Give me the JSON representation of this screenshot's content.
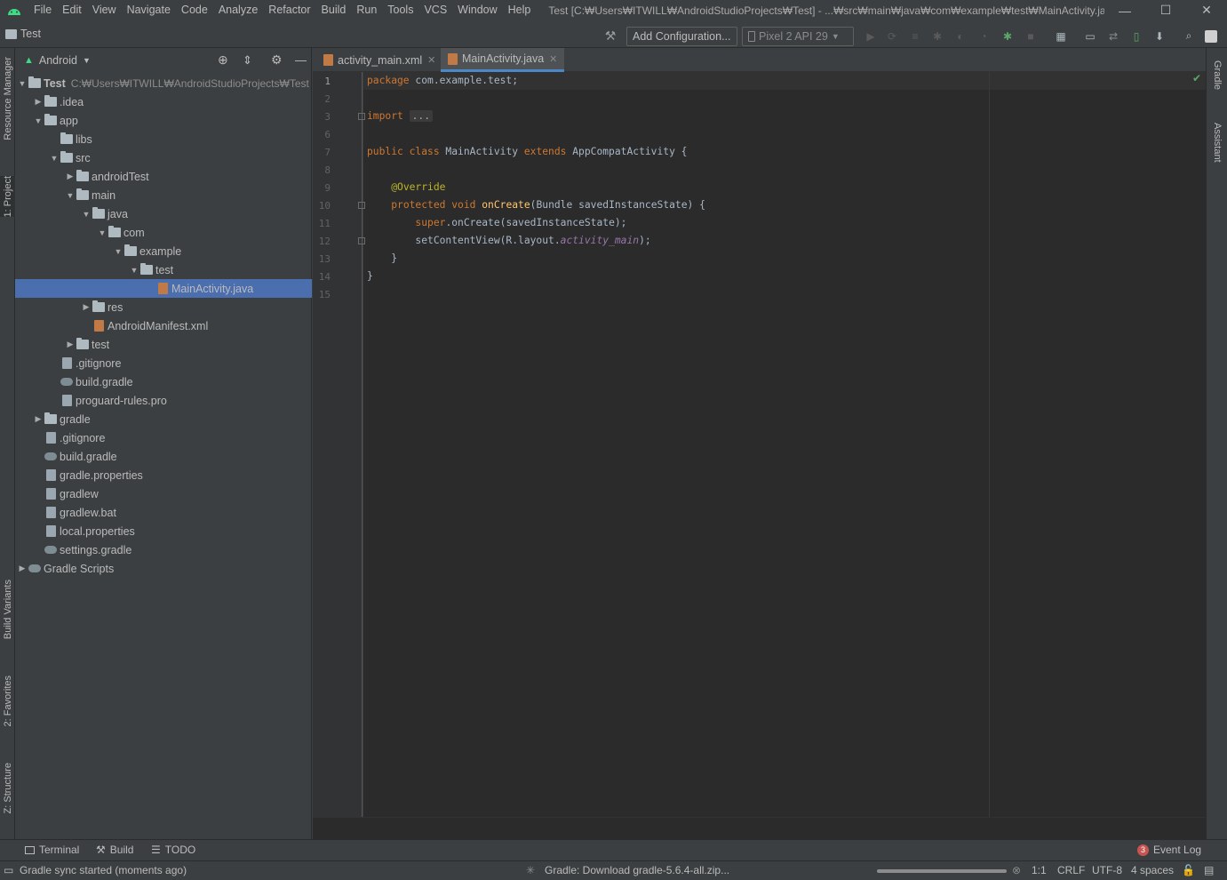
{
  "menu": {
    "items": [
      "File",
      "Edit",
      "View",
      "Navigate",
      "Code",
      "Analyze",
      "Refactor",
      "Build",
      "Run",
      "Tools",
      "VCS",
      "Window",
      "Help"
    ],
    "window_title": "Test [C:₩Users₩ITWILL₩AndroidStudioProjects₩Test] - ...₩src₩main₩java₩com₩example₩test₩MainActivity.java"
  },
  "navbar": {
    "project": "Test",
    "add_config": "Add Configuration...",
    "device": "Pixel 2 API 29"
  },
  "left_tabs": [
    "Resource Manager",
    "1: Project",
    "Build Variants",
    "2: Favorites",
    "Z: Structure"
  ],
  "right_tabs": [
    "Gradle",
    "Assistant"
  ],
  "project_panel": {
    "view": "Android",
    "root_name": "Test",
    "root_path": "C:₩Users₩ITWILL₩AndroidStudioProjects₩Test",
    "tree": [
      {
        "label": "Test",
        "depth": 0,
        "arrow": "down",
        "icon": "project-folder-icon"
      },
      {
        "label": ".idea",
        "depth": 1,
        "arrow": "right",
        "icon": "folder-icon"
      },
      {
        "label": "app",
        "depth": 1,
        "arrow": "down",
        "icon": "folder-icon"
      },
      {
        "label": "libs",
        "depth": 2,
        "arrow": "",
        "icon": "folder-icon"
      },
      {
        "label": "src",
        "depth": 2,
        "arrow": "down",
        "icon": "folder-icon"
      },
      {
        "label": "androidTest",
        "depth": 3,
        "arrow": "right",
        "icon": "folder-icon"
      },
      {
        "label": "main",
        "depth": 3,
        "arrow": "down",
        "icon": "folder-icon"
      },
      {
        "label": "java",
        "depth": 4,
        "arrow": "down",
        "icon": "folder-icon"
      },
      {
        "label": "com",
        "depth": 5,
        "arrow": "down",
        "icon": "folder-icon"
      },
      {
        "label": "example",
        "depth": 6,
        "arrow": "down",
        "icon": "folder-icon"
      },
      {
        "label": "test",
        "depth": 7,
        "arrow": "down",
        "icon": "folder-icon"
      },
      {
        "label": "MainActivity.java",
        "depth": 8,
        "arrow": "",
        "icon": "java-file-icon",
        "selected": true
      },
      {
        "label": "res",
        "depth": 4,
        "arrow": "right",
        "icon": "folder-icon"
      },
      {
        "label": "AndroidManifest.xml",
        "depth": 4,
        "arrow": "",
        "icon": "manifest-file-icon"
      },
      {
        "label": "test",
        "depth": 3,
        "arrow": "right",
        "icon": "folder-icon"
      },
      {
        "label": ".gitignore",
        "depth": 2,
        "arrow": "",
        "icon": "gitignore-file-icon"
      },
      {
        "label": "build.gradle",
        "depth": 2,
        "arrow": "",
        "icon": "gradle-file-icon"
      },
      {
        "label": "proguard-rules.pro",
        "depth": 2,
        "arrow": "",
        "icon": "text-file-icon"
      },
      {
        "label": "gradle",
        "depth": 1,
        "arrow": "right",
        "icon": "folder-icon"
      },
      {
        "label": ".gitignore",
        "depth": 1,
        "arrow": "",
        "icon": "gitignore-file-icon"
      },
      {
        "label": "build.gradle",
        "depth": 1,
        "arrow": "",
        "icon": "gradle-file-icon"
      },
      {
        "label": "gradle.properties",
        "depth": 1,
        "arrow": "",
        "icon": "properties-file-icon"
      },
      {
        "label": "gradlew",
        "depth": 1,
        "arrow": "",
        "icon": "script-file-icon"
      },
      {
        "label": "gradlew.bat",
        "depth": 1,
        "arrow": "",
        "icon": "text-file-icon"
      },
      {
        "label": "local.properties",
        "depth": 1,
        "arrow": "",
        "icon": "properties-file-icon"
      },
      {
        "label": "settings.gradle",
        "depth": 1,
        "arrow": "",
        "icon": "gradle-file-icon"
      },
      {
        "label": "Gradle Scripts",
        "depth": 0,
        "arrow": "right",
        "icon": "gradle-scripts-icon"
      }
    ]
  },
  "editor_tabs": [
    {
      "label": "activity_main.xml",
      "active": false
    },
    {
      "label": "MainActivity.java",
      "active": true
    }
  ],
  "code_lines": [
    {
      "n": "1",
      "html": "<span class=\"kw\">package</span> com.example.test;"
    },
    {
      "n": "2",
      "html": ""
    },
    {
      "n": "3",
      "html": "<span class=\"kw\">import</span> <span class=\"fold\">...</span>"
    },
    {
      "n": "6",
      "html": ""
    },
    {
      "n": "7",
      "html": "<span class=\"kw\">public class</span> MainActivity <span class=\"kw\">extends</span> AppCompatActivity {"
    },
    {
      "n": "8",
      "html": ""
    },
    {
      "n": "9",
      "html": "    <span class=\"ann\">@Override</span>"
    },
    {
      "n": "10",
      "html": "    <span class=\"kw\">protected void</span> <span class=\"mth\">onCreate</span>(Bundle savedInstanceState) {"
    },
    {
      "n": "11",
      "html": "        <span class=\"kw\">super</span>.onCreate(savedInstanceState);"
    },
    {
      "n": "12",
      "html": "        setContentView(R.layout.<span class=\"kw\" style=\"color:#9876aa;font-style:italic\">activity_main</span>);"
    },
    {
      "n": "13",
      "html": "    }"
    },
    {
      "n": "14",
      "html": "}"
    },
    {
      "n": "15",
      "html": ""
    }
  ],
  "bottom_tabs": [
    "Terminal",
    "Build",
    "TODO"
  ],
  "event_log": {
    "label": "Event Log",
    "count": "3"
  },
  "status": {
    "message": "Gradle sync started (moments ago)",
    "progress": "Gradle: Download gradle-5.6.4-all.zip...",
    "position": "1:1",
    "line_sep": "CRLF",
    "encoding": "UTF-8",
    "indent": "4 spaces"
  }
}
